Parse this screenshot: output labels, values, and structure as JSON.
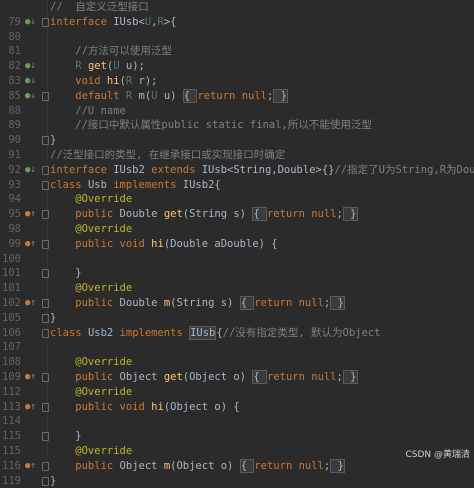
{
  "editor": {
    "lines": [
      {
        "ln": "",
        "gutter": "",
        "fold": false,
        "segs": [
          [
            "cm",
            "//  自定义泛型接口"
          ]
        ]
      },
      {
        "ln": "79",
        "gutter": "impl",
        "fold": true,
        "segs": [
          [
            "kw",
            "interface "
          ],
          [
            "",
            "IUsb<"
          ],
          [
            "tp",
            "U"
          ],
          [
            "",
            ","
          ],
          [
            "tp",
            "R"
          ],
          [
            "",
            ">{"
          ]
        ]
      },
      {
        "ln": "80",
        "gutter": "",
        "fold": false,
        "segs": []
      },
      {
        "ln": "81",
        "gutter": "",
        "fold": false,
        "segs": [
          [
            "cm",
            "    //方法可以使用泛型"
          ]
        ]
      },
      {
        "ln": "82",
        "gutter": "impl",
        "fold": false,
        "segs": [
          [
            "tp",
            "    R "
          ],
          [
            "fn",
            "get"
          ],
          [
            "",
            "("
          ],
          [
            "tp",
            "U"
          ],
          [
            "",
            " u);"
          ]
        ]
      },
      {
        "ln": "83",
        "gutter": "impl",
        "fold": false,
        "segs": [
          [
            "kw",
            "    void "
          ],
          [
            "fn",
            "hi"
          ],
          [
            "",
            "("
          ],
          [
            "tp",
            "R"
          ],
          [
            "",
            " r);"
          ]
        ]
      },
      {
        "ln": "85",
        "gutter": "impl",
        "fold": true,
        "segs": [
          [
            "kw",
            "    default "
          ],
          [
            "tp",
            "R "
          ],
          [
            "",
            "m("
          ],
          [
            "tp",
            "U"
          ],
          [
            "",
            " u) "
          ],
          [
            "hl",
            "{ "
          ],
          [
            "kw",
            "return null"
          ],
          [
            "",
            ";"
          ],
          [
            "hl",
            " }"
          ]
        ]
      },
      {
        "ln": "88",
        "gutter": "",
        "fold": false,
        "segs": [
          [
            "cm",
            "    //U name"
          ]
        ]
      },
      {
        "ln": "89",
        "gutter": "",
        "fold": false,
        "segs": [
          [
            "cm",
            "    //接口中默认属性public static final,所以不能使用泛型"
          ]
        ]
      },
      {
        "ln": "90",
        "gutter": "",
        "fold": true,
        "segs": [
          [
            "",
            "}"
          ]
        ]
      },
      {
        "ln": "91",
        "gutter": "",
        "fold": false,
        "segs": [
          [
            "cm",
            "//泛型接口的类型, 在继承接口或实现接口时确定"
          ]
        ]
      },
      {
        "ln": "92",
        "gutter": "impl",
        "fold": true,
        "segs": [
          [
            "kw",
            "interface "
          ],
          [
            "",
            "IUsb2 "
          ],
          [
            "kw",
            "extends "
          ],
          [
            "",
            "IUsb<String,Double>{}"
          ],
          [
            "cm",
            "//指定了U为String,R为Double"
          ]
        ]
      },
      {
        "ln": "93",
        "gutter": "",
        "fold": true,
        "segs": [
          [
            "kw",
            "class "
          ],
          [
            "",
            "Usb "
          ],
          [
            "kw",
            "implements "
          ],
          [
            "",
            "IUsb2{"
          ]
        ]
      },
      {
        "ln": "94",
        "gutter": "",
        "fold": false,
        "segs": [
          [
            "an",
            "    @Override"
          ]
        ]
      },
      {
        "ln": "95",
        "gutter": "over",
        "fold": true,
        "segs": [
          [
            "kw",
            "    public "
          ],
          [
            "",
            "Double "
          ],
          [
            "fn",
            "get"
          ],
          [
            "",
            "(String s) "
          ],
          [
            "hl",
            "{ "
          ],
          [
            "kw",
            "return null"
          ],
          [
            "",
            ";"
          ],
          [
            "hl",
            " }"
          ]
        ]
      },
      {
        "ln": "98",
        "gutter": "",
        "fold": false,
        "segs": [
          [
            "an",
            "    @Override"
          ]
        ]
      },
      {
        "ln": "99",
        "gutter": "over",
        "fold": true,
        "segs": [
          [
            "kw",
            "    public void "
          ],
          [
            "fn",
            "hi"
          ],
          [
            "",
            "(Double aDouble) {"
          ]
        ]
      },
      {
        "ln": "100",
        "gutter": "",
        "fold": false,
        "segs": []
      },
      {
        "ln": "101",
        "gutter": "",
        "fold": true,
        "segs": [
          [
            "",
            "    }"
          ]
        ]
      },
      {
        "ln": "101",
        "gutter": "",
        "fold": false,
        "segs": [
          [
            "an",
            "    @Override"
          ]
        ]
      },
      {
        "ln": "102",
        "gutter": "over",
        "fold": true,
        "segs": [
          [
            "kw",
            "    public "
          ],
          [
            "",
            "Double "
          ],
          [
            "fn",
            "m"
          ],
          [
            "",
            "(String s) "
          ],
          [
            "hl",
            "{ "
          ],
          [
            "kw",
            "return null"
          ],
          [
            "",
            ";"
          ],
          [
            "hl",
            " }"
          ]
        ]
      },
      {
        "ln": "105",
        "gutter": "",
        "fold": true,
        "segs": [
          [
            "",
            "}"
          ]
        ]
      },
      {
        "ln": "106",
        "gutter": "",
        "fold": true,
        "segs": [
          [
            "kw",
            "class "
          ],
          [
            "",
            "Usb2 "
          ],
          [
            "kw",
            "implements "
          ],
          [
            "hl",
            "IUsb"
          ],
          [
            "",
            "{"
          ],
          [
            "cm",
            "//没有指定类型, 默认为Object"
          ]
        ]
      },
      {
        "ln": "107",
        "gutter": "",
        "fold": false,
        "segs": []
      },
      {
        "ln": "108",
        "gutter": "",
        "fold": false,
        "segs": [
          [
            "an",
            "    @Override"
          ]
        ]
      },
      {
        "ln": "109",
        "gutter": "over",
        "fold": true,
        "segs": [
          [
            "kw",
            "    public "
          ],
          [
            "",
            "Object "
          ],
          [
            "fn",
            "get"
          ],
          [
            "",
            "(Object o) "
          ],
          [
            "hl",
            "{ "
          ],
          [
            "kw",
            "return null"
          ],
          [
            "",
            ";"
          ],
          [
            "hl",
            " }"
          ]
        ]
      },
      {
        "ln": "112",
        "gutter": "",
        "fold": false,
        "segs": [
          [
            "an",
            "    @Override"
          ]
        ]
      },
      {
        "ln": "113",
        "gutter": "over",
        "fold": true,
        "segs": [
          [
            "kw",
            "    public void "
          ],
          [
            "fn",
            "hi"
          ],
          [
            "",
            "(Object o) {"
          ]
        ]
      },
      {
        "ln": "114",
        "gutter": "",
        "fold": false,
        "segs": []
      },
      {
        "ln": "115",
        "gutter": "",
        "fold": true,
        "segs": [
          [
            "",
            "    }"
          ]
        ]
      },
      {
        "ln": "115",
        "gutter": "",
        "fold": false,
        "segs": [
          [
            "an",
            "    @Override"
          ]
        ]
      },
      {
        "ln": "116",
        "gutter": "over",
        "fold": true,
        "segs": [
          [
            "kw",
            "    public "
          ],
          [
            "",
            "Object "
          ],
          [
            "fn",
            "m"
          ],
          [
            "",
            "(Object o) "
          ],
          [
            "hl",
            "{ "
          ],
          [
            "kw",
            "return null"
          ],
          [
            "",
            ";"
          ],
          [
            "hl",
            " }"
          ]
        ]
      },
      {
        "ln": "119",
        "gutter": "",
        "fold": true,
        "segs": [
          [
            "",
            "}"
          ]
        ]
      }
    ]
  },
  "watermark": "CSDN @黄瑞清",
  "colors": {
    "background": "#2b2b2b",
    "keyword": "#cc7832",
    "comment": "#808080",
    "method": "#ffc66d",
    "type_param": "#507874",
    "annotation": "#bbb529",
    "text": "#a9b7c6"
  },
  "icons": {
    "impl": "implementation-gutter-icon",
    "over": "override-gutter-icon",
    "fold": "fold-marker-icon"
  }
}
